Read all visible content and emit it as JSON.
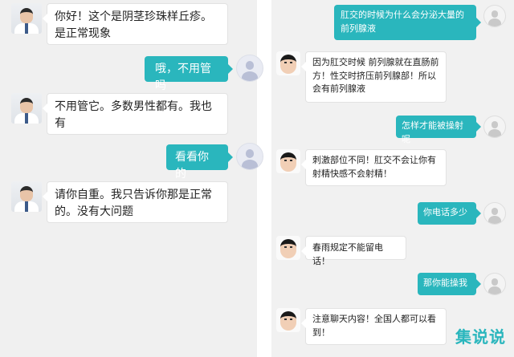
{
  "left_chat": {
    "messages": [
      {
        "from": "doctor",
        "text": "你好！这个是阴茎珍珠样丘疹。是正常现象"
      },
      {
        "from": "user",
        "text": "哦，不用管吗"
      },
      {
        "from": "doctor",
        "text": "不用管它。多数男性都有。我也有"
      },
      {
        "from": "user",
        "text": "看看你的"
      },
      {
        "from": "doctor",
        "text": "请你自重。我只告诉你那是正常的。没有大问题"
      }
    ]
  },
  "right_chat": {
    "messages": [
      {
        "from": "user",
        "text": "肛交的时候为什么会分泌大量的前列腺液"
      },
      {
        "from": "doctor",
        "text": "因为肛交时候 前列腺就在直肠前方！性交时挤压前列腺部！所以会有前列腺液"
      },
      {
        "from": "user",
        "text": "怎样才能被操射呢"
      },
      {
        "from": "doctor",
        "text": "刺激部位不同！肛交不会让你有射精快感不会射精！"
      },
      {
        "from": "user",
        "text": "你电话多少"
      },
      {
        "from": "doctor",
        "text": "春雨规定不能留电话！"
      },
      {
        "from": "user",
        "text": "那你能操我"
      },
      {
        "from": "doctor",
        "text": "注意聊天内容！全国人都可以看到！"
      }
    ]
  },
  "watermark": {
    "text": "集说说"
  },
  "colors": {
    "outgoing_bubble": "#2ab6bd",
    "left_background": "#f0f0f0",
    "right_background": "#f1f1f1"
  }
}
